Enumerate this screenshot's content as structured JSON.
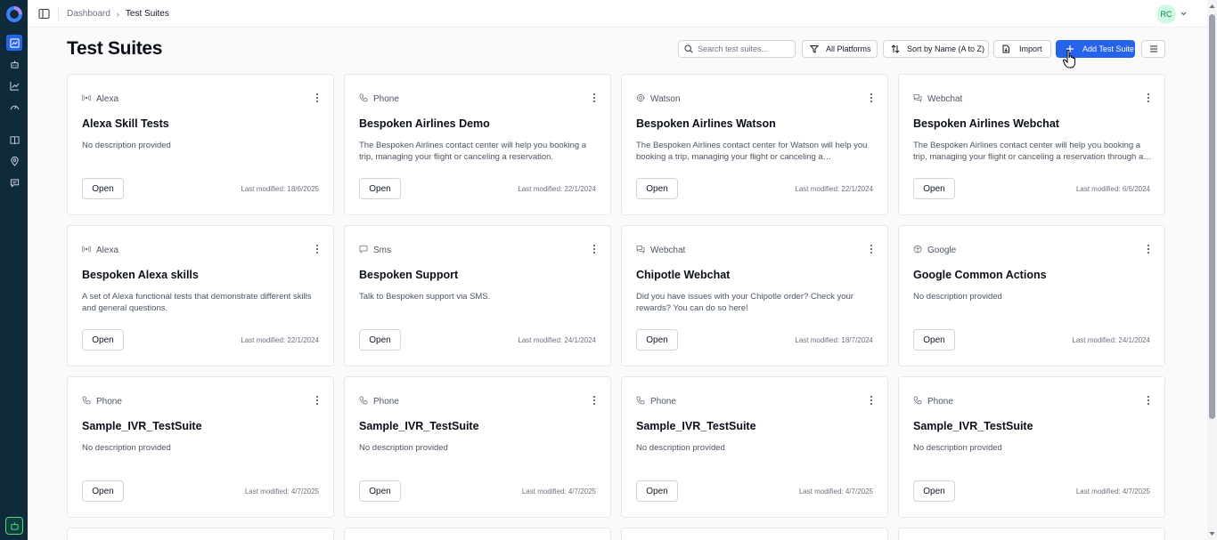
{
  "topbar": {
    "breadcrumb": [
      "Dashboard",
      "Test Suites"
    ],
    "avatar_initials": "RC"
  },
  "page": {
    "title": "Test Suites",
    "search_placeholder": "Search test suites...",
    "filter_label": "All Platforms",
    "sort_label": "Sort by Name (A to Z)",
    "import_label": "Import",
    "add_label": "Add Test Suite"
  },
  "sidebar": {
    "items": [
      "dashboard-icon",
      "bot-icon",
      "chart-icon",
      "gauge-icon",
      "book-icon",
      "location-icon",
      "message-icon"
    ],
    "active": 0
  },
  "colors": {
    "accent": "#2563eb",
    "sidebar": "#0f2a3a"
  },
  "cards": [
    {
      "platform": "Alexa",
      "icon": "alexa-icon",
      "name": "Alexa Skill Tests",
      "desc": "No description provided",
      "open": "Open",
      "modified": "Last modified: 18/6/2025"
    },
    {
      "platform": "Phone",
      "icon": "phone-icon",
      "name": "Bespoken Airlines Demo",
      "desc": "The Bespoken Airlines contact center will help you booking a trip, managing your flight or canceling a reservation.",
      "open": "Open",
      "modified": "Last modified: 22/1/2024"
    },
    {
      "platform": "Watson",
      "icon": "watson-icon",
      "name": "Bespoken Airlines Watson",
      "desc": "The Bespoken Airlines contact center for Watson will help you booking a trip, managing your flight or canceling a reservation…",
      "open": "Open",
      "modified": "Last modified: 22/1/2024"
    },
    {
      "platform": "Webchat",
      "icon": "webchat-icon",
      "name": "Bespoken Airlines Webchat",
      "desc": "The Bespoken Airlines contact center will help you booking a trip, managing your flight or canceling a reservation through a…",
      "open": "Open",
      "modified": "Last modified: 6/6/2024"
    },
    {
      "platform": "Alexa",
      "icon": "alexa-icon",
      "name": "Bespoken Alexa skills",
      "desc": "A set of Alexa functional tests that demonstrate different skills and general questions.",
      "open": "Open",
      "modified": "Last modified: 22/1/2024"
    },
    {
      "platform": "Sms",
      "icon": "sms-icon",
      "name": "Bespoken Support",
      "desc": "Talk to Bespoken support via SMS.",
      "open": "Open",
      "modified": "Last modified: 24/1/2024"
    },
    {
      "platform": "Webchat",
      "icon": "webchat-icon",
      "name": "Chipotle Webchat",
      "desc": "Did you have issues with your Chipotle order? Check your rewards? You can do so here!",
      "open": "Open",
      "modified": "Last modified: 18/7/2024"
    },
    {
      "platform": "Google",
      "icon": "google-icon",
      "name": "Google Common Actions",
      "desc": "No description provided",
      "open": "Open",
      "modified": "Last modified: 24/1/2024"
    },
    {
      "platform": "Phone",
      "icon": "phone-icon",
      "name": "Sample_IVR_TestSuite",
      "desc": "No description provided",
      "open": "Open",
      "modified": "Last modified: 4/7/2025"
    },
    {
      "platform": "Phone",
      "icon": "phone-icon",
      "name": "Sample_IVR_TestSuite",
      "desc": "No description provided",
      "open": "Open",
      "modified": "Last modified: 4/7/2025"
    },
    {
      "platform": "Phone",
      "icon": "phone-icon",
      "name": "Sample_IVR_TestSuite",
      "desc": "No description provided",
      "open": "Open",
      "modified": "Last modified: 4/7/2025"
    },
    {
      "platform": "Phone",
      "icon": "phone-icon",
      "name": "Sample_IVR_TestSuite",
      "desc": "No description provided",
      "open": "Open",
      "modified": "Last modified: 4/7/2025"
    }
  ]
}
